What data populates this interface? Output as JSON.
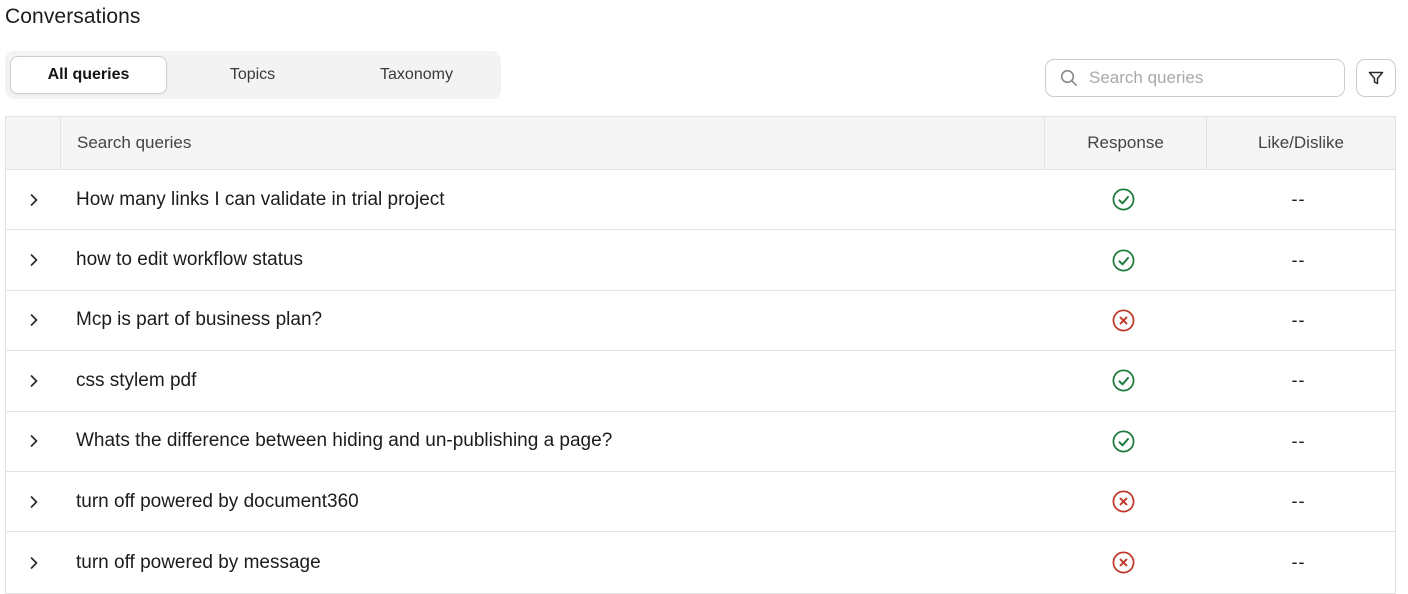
{
  "page": {
    "title": "Conversations"
  },
  "tabs": [
    {
      "label": "All queries",
      "active": true
    },
    {
      "label": "Topics",
      "active": false
    },
    {
      "label": "Taxonomy",
      "active": false
    }
  ],
  "search": {
    "placeholder": "Search queries",
    "value": ""
  },
  "icons": {
    "search": "search-icon",
    "filter": "filter-icon",
    "expand": "chevron-right-icon",
    "success": "check-circle-icon",
    "failure": "x-circle-icon"
  },
  "colors": {
    "success": "#1e7a3c",
    "failure": "#c0392b"
  },
  "table": {
    "headers": {
      "query": "Search queries",
      "response": "Response",
      "like": "Like/Dislike"
    },
    "rows": [
      {
        "query": "How many links I can validate in trial project",
        "response": "success",
        "like": "--"
      },
      {
        "query": "how to edit workflow status",
        "response": "success",
        "like": "--"
      },
      {
        "query": "Mcp is part of business plan?",
        "response": "failure",
        "like": "--"
      },
      {
        "query": "css stylem pdf",
        "response": "success",
        "like": "--"
      },
      {
        "query": "Whats the difference between hiding and un-publishing a page?",
        "response": "success",
        "like": "--"
      },
      {
        "query": "turn off powered by document360",
        "response": "failure",
        "like": "--"
      },
      {
        "query": "turn off powered by message",
        "response": "failure",
        "like": "--"
      }
    ]
  }
}
